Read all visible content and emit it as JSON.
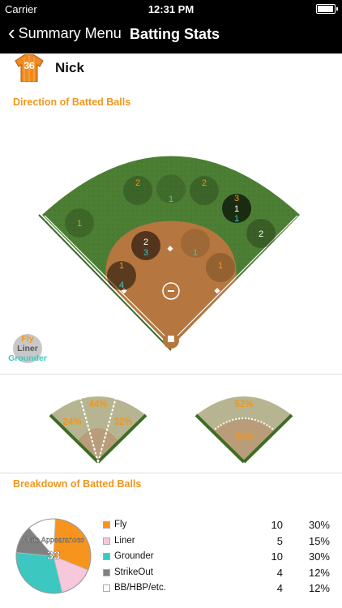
{
  "status": {
    "carrier": "Carrier",
    "time": "12:31 PM"
  },
  "nav": {
    "back_label": "Summary Menu",
    "title": "Batting Stats"
  },
  "player": {
    "name": "Nick",
    "number": "36"
  },
  "sections": {
    "direction": "Direction of Batted Balls",
    "breakdown": "Breakdown of Batted Balls"
  },
  "field_legend": {
    "fly": "Fly",
    "liner": "Liner",
    "grounder": "Grounder"
  },
  "spray_zones": {
    "lf": {
      "fly": "1"
    },
    "lcf": {
      "fly": "2"
    },
    "cf": {
      "liner": "1"
    },
    "rcf": {
      "fly": "2"
    },
    "rfl": {
      "fly": "3",
      "liner": "1",
      "grounder": "1"
    },
    "rf": {
      "fly": "2"
    },
    "ss": {
      "fly": "2",
      "grounder": "3"
    },
    "2b": {
      "grounder": "1"
    },
    "3b": {
      "fly": "1",
      "grounder": "4"
    },
    "1b": {
      "fly": "1"
    }
  },
  "mini_fields": {
    "left": {
      "left": "24%",
      "center": "44%",
      "right": "32%"
    },
    "right": {
      "outfield": "52%",
      "infield": "48%"
    }
  },
  "pie": {
    "label": "Plate Appearances",
    "total": "33",
    "slices": [
      {
        "name": "Fly",
        "value": 10,
        "color": "#f7941d"
      },
      {
        "name": "Liner",
        "value": 5,
        "color": "#f7c8dc"
      },
      {
        "name": "Grounder",
        "value": 10,
        "color": "#3cc8c0"
      },
      {
        "name": "StrikeOut",
        "value": 4,
        "color": "#808080"
      },
      {
        "name": "BB/HBP/etc.",
        "value": 4,
        "color": "#ffffff"
      }
    ]
  },
  "breakdown": [
    {
      "label": "Fly",
      "count": "10",
      "pct": "30%",
      "color": "#f7941d"
    },
    {
      "label": "Liner",
      "count": "5",
      "pct": "15%",
      "color": "#f7c8dc"
    },
    {
      "label": "Grounder",
      "count": "10",
      "pct": "30%",
      "color": "#3cc8c0"
    },
    {
      "label": "StrikeOut",
      "count": "4",
      "pct": "12%",
      "color": "#808080"
    },
    {
      "label": "BB/HBP/etc.",
      "count": "4",
      "pct": "12%",
      "color": "#ffffff"
    }
  ],
  "colors": {
    "fly": "#f0961e",
    "liner": "#ffffff",
    "grounder": "#3cc8c0",
    "accent": "#f0961e"
  }
}
